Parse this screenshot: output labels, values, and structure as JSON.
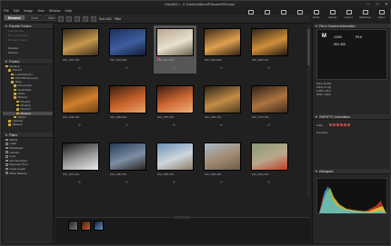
{
  "app": {
    "title": "ViewNX-i - C:\\Users\\Nikon\\Pictures\\Photos\\"
  },
  "window_buttons": [
    "–",
    "□",
    "✕"
  ],
  "menu": [
    "File",
    "Edit",
    "Image",
    "View",
    "Window",
    "Help"
  ],
  "modes": [
    {
      "label": "Browse",
      "active": true
    },
    {
      "label": "View",
      "active": false
    },
    {
      "label": "Web",
      "active": false
    }
  ],
  "toolbar_right": [
    "Capture NX-D",
    "Edit",
    "Movie",
    "Print",
    "Email",
    "Upload",
    "Export",
    "Slideshow",
    "Adjust"
  ],
  "left": {
    "favorite_heading": "Favorite Folders",
    "favorite_rows": [
      "Add Favorite",
      "Remove Favorite",
      "Browse Folders"
    ],
    "desktop_rows": [
      "Desktop",
      "Pictures"
    ],
    "folders_heading": "Folders",
    "tree": [
      {
        "label": "Desktop",
        "indent": 0
      },
      {
        "label": "This PC",
        "indent": 1
      },
      {
        "label": "Local Disk (C:)",
        "indent": 2
      },
      {
        "label": "DVD RW Drive (D:)",
        "indent": 2
      },
      {
        "label": "Nikon",
        "indent": 2
      },
      {
        "label": "Documents",
        "indent": 3
      },
      {
        "label": "Downloads",
        "indent": 3
      },
      {
        "label": "Music",
        "indent": 3
      },
      {
        "label": "Pictures",
        "indent": 3
      },
      {
        "label": "Photos1",
        "indent": 4
      },
      {
        "label": "Photos2",
        "indent": 4
      },
      {
        "label": "Photos3",
        "indent": 4
      },
      {
        "label": "Photos4",
        "indent": 4,
        "selected": true
      },
      {
        "label": "Videos",
        "indent": 3
      },
      {
        "label": "Libraries",
        "indent": 1
      },
      {
        "label": "Network",
        "indent": 1
      }
    ],
    "filters_heading": "Filters",
    "filters": [
      "Rating",
      "Label",
      "Pick/Reject",
      "Camera",
      "Lens",
      "ISO Sensitivity",
      "Exposure Time",
      "Focal Length",
      "White Balance"
    ]
  },
  "center": {
    "sort_label": "Sort: ASC",
    "filter_label": "Filter",
    "thumbnails": [
      {
        "caption": "DSC_0007.JPG",
        "colors": [
          "#2a2418",
          "#c7984d",
          "#3a2c1f"
        ]
      },
      {
        "caption": "DSC_0012.NEF",
        "colors": [
          "#1e2f5a",
          "#3d5ea0",
          "#101c3a"
        ]
      },
      {
        "caption": "DSC_0013.JPG",
        "colors": [
          "#b7a790",
          "#e9e1cf",
          "#6c5d48"
        ],
        "selected": true
      },
      {
        "caption": "DSC_0034.NEF",
        "colors": [
          "#3b2a18",
          "#e1a04f",
          "#2b1e11"
        ]
      },
      {
        "caption": "DSC_0045.JPG",
        "colors": [
          "#2e2418",
          "#d08f3a",
          "#1e160f"
        ]
      },
      {
        "caption": "DSC_0048.JPG",
        "colors": [
          "#3a2410",
          "#d0802c",
          "#6b4015"
        ]
      },
      {
        "caption": "DSC_0050.NEF",
        "colors": [
          "#3b1d10",
          "#c7612b",
          "#e9a266"
        ]
      },
      {
        "caption": "DSC_0055.JPG",
        "colors": [
          "#3c1d11",
          "#d06a33",
          "#f0b27c"
        ]
      },
      {
        "caption": "DSC_0060.JPG",
        "colors": [
          "#2a2116",
          "#c28d47",
          "#4f3a1f"
        ]
      },
      {
        "caption": "DSC_0078.JPG",
        "colors": [
          "#2b1f17",
          "#ad7341",
          "#3f2c1c"
        ]
      },
      {
        "caption": "DSC_0079.JPG",
        "colors": [
          "#1a1a1a",
          "#9a9a9a",
          "#eaeaea"
        ]
      },
      {
        "caption": "DSC_0080.JPG",
        "colors": [
          "#223a5a",
          "#7e8ea3",
          "#2a2420"
        ]
      },
      {
        "caption": "DSC_0086.JPG",
        "colors": [
          "#6c8fb6",
          "#cfd6dc",
          "#8a7d6b"
        ]
      },
      {
        "caption": "DSC_0090.JPG",
        "colors": [
          "#a8b9c9",
          "#a08a70",
          "#6b5c4a"
        ]
      },
      {
        "caption": "DSC_0094.JPG",
        "colors": [
          "#8a9a7a",
          "#b8a88a",
          "#c23a2a"
        ]
      }
    ],
    "filmstrip": [
      {
        "colors": [
          "#222",
          "#777"
        ]
      },
      {
        "colors": [
          "#3b1d10",
          "#c7612b"
        ]
      },
      {
        "colors": [
          "#101c3a",
          "#6c8fb6"
        ]
      }
    ]
  },
  "right": {
    "panel1_heading": "File & Camera Information",
    "mode": "M",
    "shutter": "1/200",
    "aperture": "F5.6",
    "iso": "ISO 400",
    "meta": [
      "Nikon D7200",
      "Photo 1/1 (0)",
      "1/200 s F5.6",
      "6000 x 4000",
      "ISO 400",
      "50 mm"
    ],
    "panel2_heading": "XMP/IPTC Information",
    "label_row": "Label",
    "keywords": "Keywords",
    "panel3_heading": "Histogram",
    "histo_mode": "RGB"
  }
}
